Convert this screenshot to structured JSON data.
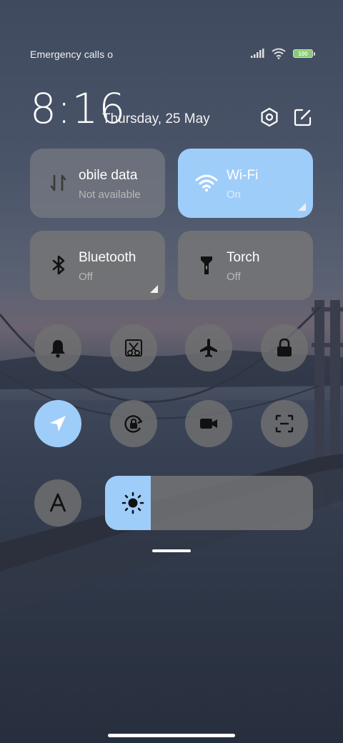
{
  "status_bar": {
    "carrier_text": "Emergency calls o",
    "battery_level": "100"
  },
  "header": {
    "time": "8:16",
    "date": "Thursday, 25 May",
    "settings_icon": "hexagon-gear-icon",
    "edit_icon": "edit-icon"
  },
  "tiles": [
    {
      "name": "obile data",
      "state": "Not available",
      "icon": "mobile-data-arrows-icon",
      "active": false
    },
    {
      "name": "Wi-Fi",
      "state": "On",
      "icon": "wifi-icon",
      "active": true
    },
    {
      "name": "Bluetooth",
      "state": "Off",
      "icon": "bluetooth-icon",
      "active": false
    },
    {
      "name": "Torch",
      "state": "Off",
      "icon": "torch-icon",
      "active": false
    }
  ],
  "toggles": [
    {
      "icon": "bell-icon",
      "active": false
    },
    {
      "icon": "screenshot-scissors-icon",
      "active": false
    },
    {
      "icon": "airplane-icon",
      "active": false
    },
    {
      "icon": "lock-icon",
      "active": false
    },
    {
      "icon": "location-arrow-icon",
      "active": true
    },
    {
      "icon": "rotation-lock-icon",
      "active": false
    },
    {
      "icon": "video-camera-icon",
      "active": false
    },
    {
      "icon": "scan-icon",
      "active": false
    },
    {
      "icon": "font-a-icon",
      "active": false
    }
  ],
  "brightness": {
    "level": 0.22,
    "icon": "sun-icon"
  },
  "colors": {
    "accent": "#9fcdfa",
    "tile": "#767676"
  }
}
